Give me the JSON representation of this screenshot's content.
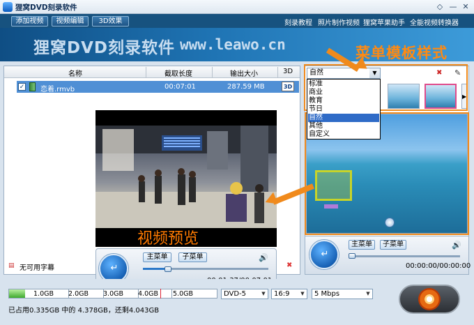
{
  "window": {
    "title": "狸窝DVD刻录软件",
    "controls": [
      "◇",
      "—",
      "✕"
    ]
  },
  "menubar": {
    "left_buttons": [
      "添加视频",
      "视频编辑",
      "3D效果"
    ],
    "right_links": [
      "刻录教程",
      "照片制作视频",
      "狸窝苹果助手",
      "全能视频转换器"
    ]
  },
  "banner": {
    "title": "狸窝DVD刻录软件",
    "url": "www.leawo.cn",
    "annotation": "菜单模板样式"
  },
  "file_table": {
    "columns": [
      "名称",
      "截取长度",
      "输出大小",
      "3D"
    ],
    "rows": [
      {
        "name": "恋着.rmvb",
        "duration": "00:07:01",
        "size": "287.59 MB",
        "checked": true
      }
    ]
  },
  "preview": {
    "label": "视频预览",
    "main_menu": "主菜单",
    "sub_menu": "子菜单",
    "time": "00:01:37/00:07:01",
    "progress": 0.2
  },
  "subtitle": {
    "label": "无可用字幕"
  },
  "template": {
    "selected": "自然",
    "options": [
      "标准",
      "商业",
      "教育",
      "节日",
      "自然",
      "其他",
      "自定义"
    ],
    "selected_index": 4
  },
  "right_player": {
    "main_menu": "主菜单",
    "sub_menu": "子菜单",
    "time": "00:00:00/00:00:00"
  },
  "capacity": {
    "marks": [
      "1.0GB",
      "2.0GB",
      "3.0GB",
      "4.0GB",
      "5.0GB"
    ],
    "fill_fraction": 0.077
  },
  "disc_type": "DVD-5",
  "aspect": "16:9",
  "bitrate": "5 Mbps",
  "usage_text": "已占用0.335GB 中的 4.378GB，还剩4.043GB",
  "colors": {
    "accent": "#f08a1c",
    "selection": "#4f8fd5",
    "menubar": "#17527f"
  }
}
